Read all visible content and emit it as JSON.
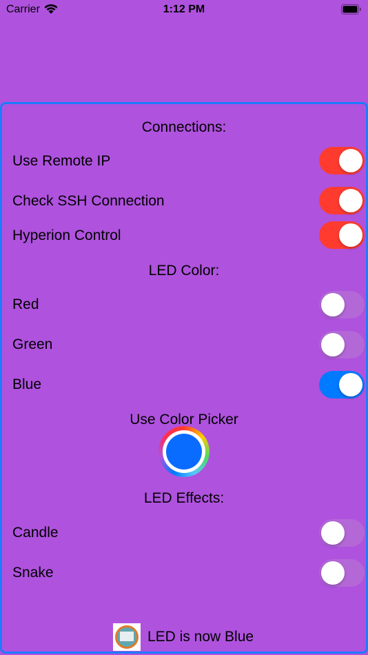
{
  "status_bar": {
    "carrier": "Carrier",
    "time": "1:12 PM"
  },
  "connections": {
    "heading": "Connections:",
    "items": [
      {
        "label": "Use Remote IP",
        "on": true
      },
      {
        "label": "Check SSH Connection",
        "on": true
      },
      {
        "label": "Hyperion Control",
        "on": true
      }
    ]
  },
  "led_color": {
    "heading": "LED Color:",
    "items": [
      {
        "label": "Red",
        "on": false
      },
      {
        "label": "Green",
        "on": false
      },
      {
        "label": "Blue",
        "on": true
      }
    ]
  },
  "color_picker": {
    "label": "Use Color Picker",
    "selected_color": "#0a6cff"
  },
  "led_effects": {
    "heading": "LED Effects:",
    "items": [
      {
        "label": "Candle",
        "on": false
      },
      {
        "label": "Snake",
        "on": false
      }
    ]
  },
  "footer": {
    "status": "LED is now Blue"
  },
  "colors": {
    "background": "#af52de",
    "panel_border": "#1a7cff",
    "switch_on_red": "#ff3b30",
    "switch_on_blue": "#007aff"
  }
}
